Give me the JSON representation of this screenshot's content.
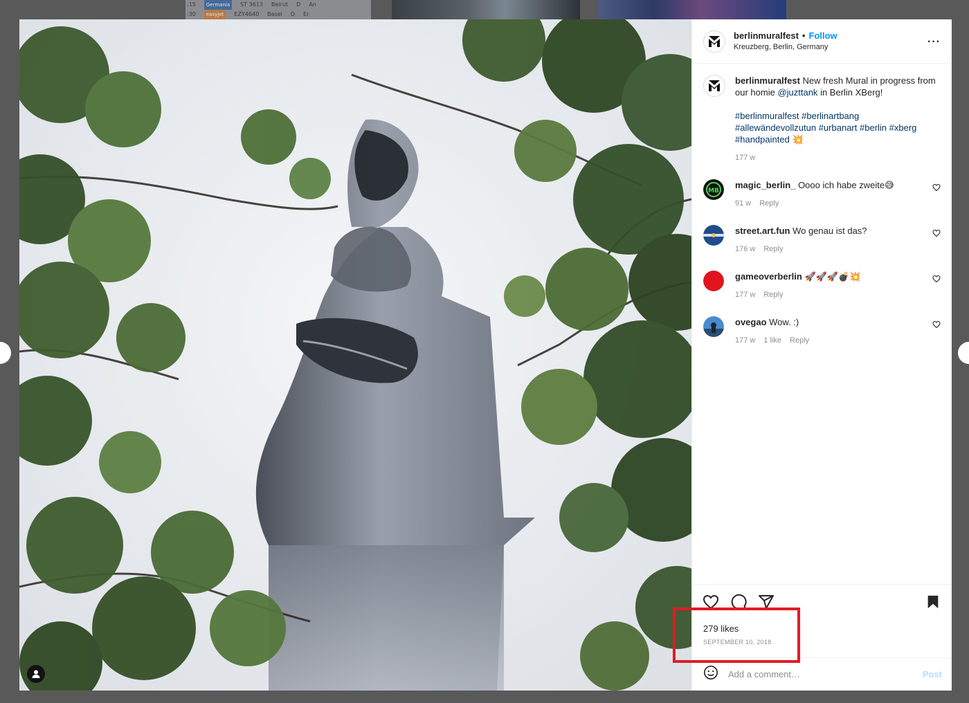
{
  "background": {
    "table_rows": [
      {
        "time": ":15",
        "flight": "ST 3613",
        "city": "Beirut",
        "gate": "D",
        "extra": "An"
      },
      {
        "time": ":30",
        "flight": "EZY4640",
        "city": "Basel",
        "gate": "D",
        "extra": "Er"
      }
    ],
    "airline_tags": [
      "Germania",
      "easyJet"
    ]
  },
  "post": {
    "username": "berlinmuralfest",
    "separator": "•",
    "follow_label": "Follow",
    "location": "Kreuzberg, Berlin, Germany",
    "more_label": "···",
    "caption": {
      "username": "berlinmuralfest",
      "text_1": "New fresh Mural in progress from our homie",
      "mention": "@juzttank",
      "text_2": "in Berlin XBerg!",
      "hashtags": [
        "#berlinmuralfest",
        "#berlinartbang",
        "#allewändevollzutun",
        "#urbanart",
        "#berlin",
        "#xberg",
        "#handpainted"
      ],
      "emoji": "💥",
      "age": "177 w"
    },
    "comments": [
      {
        "user": "magic_berlin_",
        "text": "Oooo ich habe zweite😅",
        "age": "91 w",
        "likes": "",
        "reply": "Reply",
        "avatar_color": "#111111"
      },
      {
        "user": "street.art.fun",
        "text": "Wo genau ist das?",
        "age": "176 w",
        "likes": "",
        "reply": "Reply",
        "avatar_color": "#2a5fa8"
      },
      {
        "user": "gameoverberlin",
        "text": "🚀🚀🚀💣💥",
        "age": "177 w",
        "likes": "",
        "reply": "Reply",
        "avatar_color": "#e0141e"
      },
      {
        "user": "ovegao",
        "text": "Wow. :)",
        "age": "177 w",
        "likes": "1 like",
        "reply": "Reply",
        "avatar_color": "#3b78b8"
      }
    ],
    "likes": "279 likes",
    "date": "SEPTEMBER 10, 2018",
    "add_comment_placeholder": "Add a comment…",
    "post_label": "Post"
  },
  "colors": {
    "accent": "#0095f6",
    "link": "#00376b",
    "highlight": "#e21b23",
    "overlay": "#595959"
  },
  "icons": [
    "heart-icon",
    "comment-icon",
    "share-icon",
    "bookmark-icon",
    "emoji-icon",
    "more-icon",
    "user-tag-icon",
    "chevron-left-icon",
    "chevron-right-icon"
  ]
}
